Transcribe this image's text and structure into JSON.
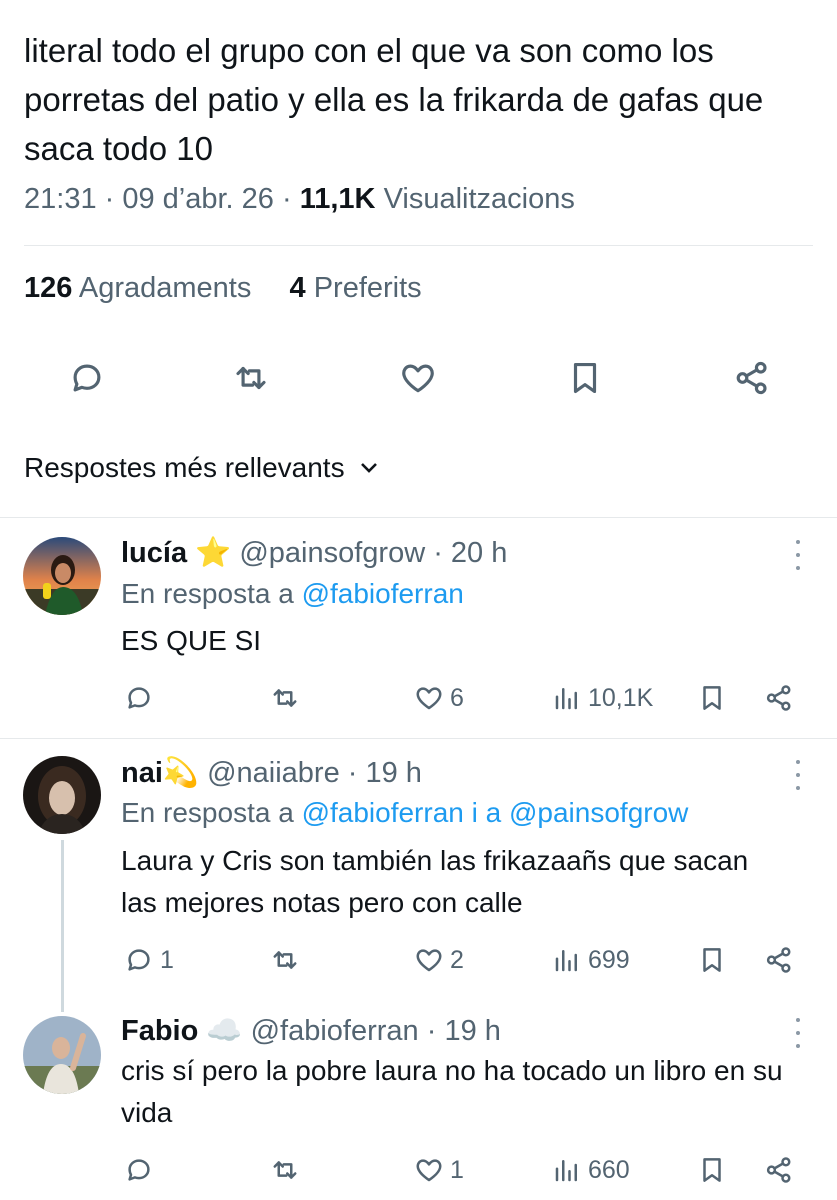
{
  "tweet": {
    "text": "literal todo el grupo con el que va son como los porretas del patio y ella es la frikarda de gafas que saca todo 10",
    "time": "21:31",
    "date": "09 d’abr. 26",
    "views_count": "11,1K",
    "views_label": "Visualitzacions",
    "likes_count": "126",
    "likes_label": "Agradaments",
    "bookmarks_count": "4",
    "bookmarks_label": "Preferits"
  },
  "sort": {
    "label": "Respostes més rellevants"
  },
  "replies": [
    {
      "name": "lucía",
      "emoji": "⭐",
      "handle": "@painsofgrow",
      "time": "20 h",
      "replying_prefix": "En resposta a",
      "replying_to": "@fabioferran",
      "text": "ES QUE SI",
      "comments": "",
      "likes": "6",
      "views": "10,1K"
    },
    {
      "name": "nai",
      "emoji": "💫",
      "handle": "@naiiabre",
      "time": "19 h",
      "replying_prefix": "En resposta a",
      "replying_to": "@fabioferran i a @painsofgrow",
      "text": "Laura y Cris son también  las frikazaañs que sacan las mejores notas pero con calle",
      "comments": "1",
      "likes": "2",
      "views": "699"
    },
    {
      "name": "Fabio",
      "emoji": "☁️",
      "handle": "@fabioferran",
      "time": "19 h",
      "text": "cris sí pero la pobre laura no ha tocado un libro en su vida",
      "comments": "",
      "likes": "1",
      "views": "660"
    }
  ],
  "colors": {
    "text": "#0f1419",
    "secondary": "#536471",
    "link": "#1d9bf0",
    "divider": "#e6e9eb",
    "thread_line": "#cfd9de"
  },
  "icons": {
    "reply": "comment-bubble-icon",
    "retweet": "retweet-icon",
    "like": "heart-icon",
    "bookmark": "bookmark-icon",
    "share": "share-icon",
    "views": "bar-chart-icon",
    "more": "more-vertical-icon"
  }
}
